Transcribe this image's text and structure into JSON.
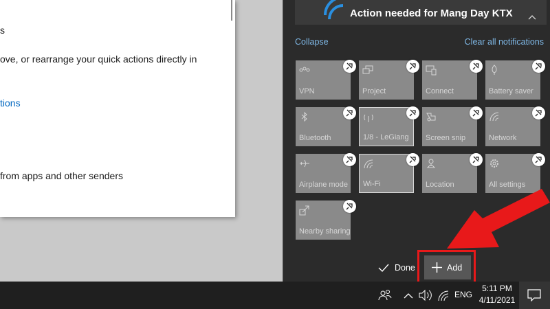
{
  "settings_window": {
    "top_glyph": "s",
    "line1": "ove, or rearrange your quick actions directly in",
    "link": "tions",
    "line2": "from apps and other senders"
  },
  "action_center": {
    "notification_title": "Action needed for Mang Day KTX",
    "collapse_label": "Collapse",
    "clear_all_label": "Clear all notifications",
    "tiles": [
      {
        "label": "VPN",
        "icon": "vpn-icon"
      },
      {
        "label": "Project",
        "icon": "project-icon"
      },
      {
        "label": "Connect",
        "icon": "connect-icon"
      },
      {
        "label": "Battery saver",
        "icon": "battery-saver-icon"
      },
      {
        "label": "Bluetooth",
        "icon": "bluetooth-icon"
      },
      {
        "label": "1/8 - LeGiang",
        "icon": "wifi-signal-icon"
      },
      {
        "label": "Screen snip",
        "icon": "screen-snip-icon"
      },
      {
        "label": "Network",
        "icon": "network-icon"
      },
      {
        "label": "Airplane mode",
        "icon": "airplane-icon"
      },
      {
        "label": "Wi-Fi",
        "icon": "wifi-icon"
      },
      {
        "label": "Location",
        "icon": "location-icon"
      },
      {
        "label": "All settings",
        "icon": "settings-gear-icon"
      },
      {
        "label": "Nearby sharing",
        "icon": "nearby-sharing-icon"
      }
    ],
    "done_label": "Done",
    "add_label": "Add"
  },
  "taskbar": {
    "language": "ENG",
    "time": "5:11 PM",
    "date": "4/11/2021"
  },
  "colors": {
    "highlight": "#e8191a",
    "tile": "#8a8a8a",
    "panel": "#2b2b2b",
    "link": "#7fb8e6"
  }
}
